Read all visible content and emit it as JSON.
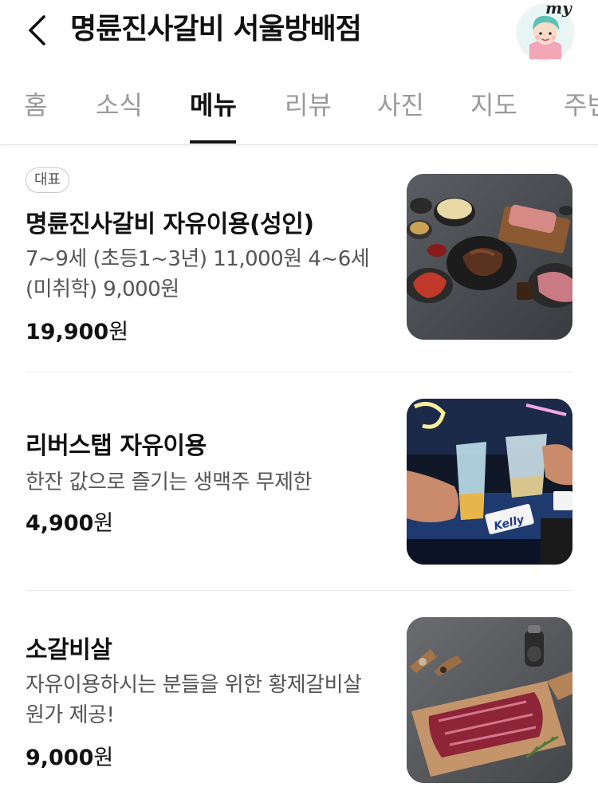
{
  "header": {
    "title": "명륜진사갈비 서울방배점",
    "avatar_label": "my"
  },
  "tabs": [
    {
      "label": "홈",
      "active": false
    },
    {
      "label": "소식",
      "active": false
    },
    {
      "label": "메뉴",
      "active": true
    },
    {
      "label": "리뷰",
      "active": false
    },
    {
      "label": "사진",
      "active": false
    },
    {
      "label": "지도",
      "active": false
    },
    {
      "label": "주변",
      "active": false
    }
  ],
  "menu": [
    {
      "badge": "대표",
      "name": "명륜진사갈비 자유이용(성인)",
      "desc": "7~9세 (초등1~3년) 11,000원 4~6세 (미취학) 9,000원",
      "price_num": "19,900",
      "price_unit": "원",
      "image": "grilled-galbi-spread"
    },
    {
      "name": "리버스탭 자유이용",
      "desc": "한잔 값으로 즐기는 생맥주 무제한",
      "price_num": "4,900",
      "price_unit": "원",
      "image": "draft-beer-cheers",
      "image_sign": "Kelly"
    },
    {
      "name": "소갈비살",
      "desc": "자유이용하시는 분들을 위한 황제갈비살 원가 제공!",
      "price_num": "9,000",
      "price_unit": "원",
      "image": "raw-beef-rib-board"
    }
  ]
}
